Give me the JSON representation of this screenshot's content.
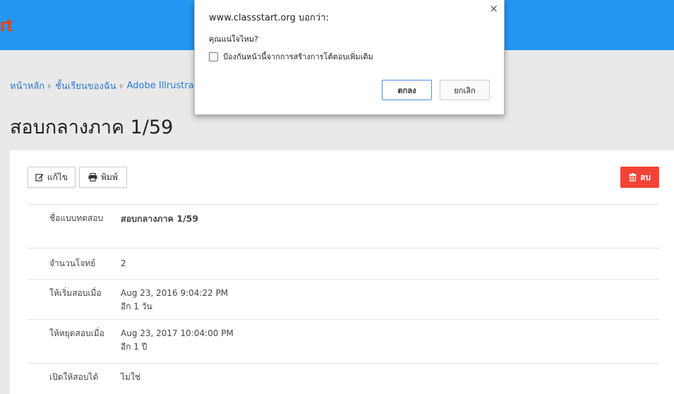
{
  "app": {
    "logo_text": "ClassStart"
  },
  "breadcrumb": [
    "หน้าหลัก",
    "ชั้นเรียนของฉัน",
    "Adobe Illrustrator"
  ],
  "page": {
    "title": "สอบกลางภาค 1/59"
  },
  "toolbar": {
    "edit_label": "แก้ไข",
    "print_label": "พิมพ์",
    "delete_label": "ลบ"
  },
  "details": [
    {
      "label": "ชื่อแบบทดสอบ",
      "value": "สอบกลางภาค 1/59",
      "sub": ""
    },
    {
      "label": "จำนวนโจทย์",
      "value": "2",
      "sub": ""
    },
    {
      "label": "ให้เริ่มสอบเมื่อ",
      "value": "Aug 23, 2016 9:04:22 PM",
      "sub": "อีก 1 วัน"
    },
    {
      "label": "ให้หยุดสอบเมื่อ",
      "value": "Aug 23, 2017 10:04:00 PM",
      "sub": "อีก 1 ปี"
    },
    {
      "label": "เปิดให้สอบได้",
      "value": "ไม่ใช่",
      "sub": ""
    }
  ],
  "dialog": {
    "title": "www.classstart.org บอกว่า:",
    "message": "คุณแน่ใจไหม?",
    "checkbox_label": "ป้องกันหน้านี้จากการสร้างการโต้ตอบเพิ่มเติม",
    "ok_label": "ตกลง",
    "cancel_label": "ยกเลิก",
    "close_glyph": "×"
  },
  "colors": {
    "topbar": "#2196f3",
    "logo": "#ff3d00",
    "delete": "#f44336",
    "link": "#2a7ad2"
  }
}
